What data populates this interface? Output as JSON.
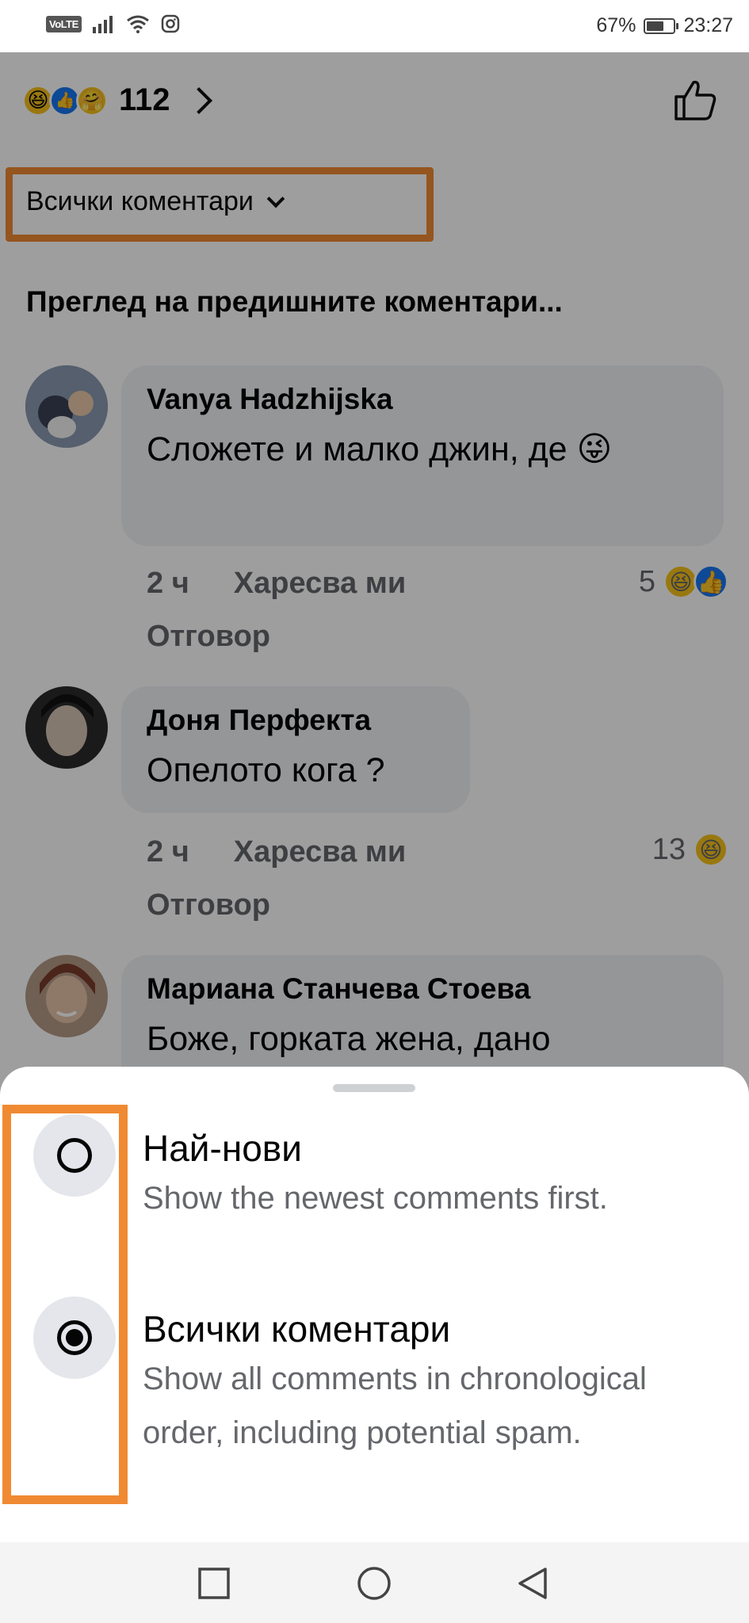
{
  "status_bar": {
    "network": "VoLTE",
    "battery_percent": "67%",
    "time": "23:27",
    "battery_level": 0.67
  },
  "post": {
    "reaction_count": "112",
    "comment_filter_label": "Всички коментари",
    "view_previous_label": "Преглед на предишните коментари..."
  },
  "comments": [
    {
      "author": "Vanya Hadzhijska",
      "text": "Сложете и малко джин, де 😜",
      "time": "2 ч",
      "like_label": "Харесва ми",
      "reply_label": "Отговор",
      "reaction_count": "5"
    },
    {
      "author": "Доня Перфекта",
      "text": "Опелото кога ?",
      "time": "2 ч",
      "like_label": "Харесва ми",
      "reply_label": "Отговор",
      "reaction_count": "13"
    },
    {
      "author": "Мариана Станчева Стоева",
      "text": "Боже, горката жена, дано"
    }
  ],
  "sort_sheet": {
    "options": [
      {
        "title": "Най-нови",
        "description": "Show the newest comments first.",
        "selected": false
      },
      {
        "title": "Всички коментари",
        "description": "Show all comments in chronological order, including potential spam.",
        "selected": true
      }
    ]
  },
  "colors": {
    "highlight": "#f08a32",
    "like_blue": "#1877f2",
    "emoji_yellow": "#f7c21a"
  }
}
